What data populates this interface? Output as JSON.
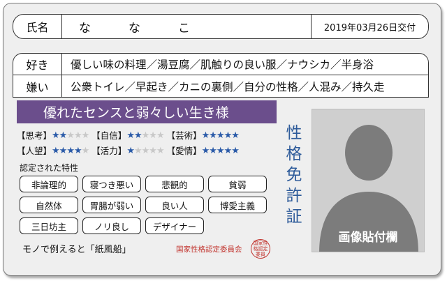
{
  "name_row": {
    "label": "氏名",
    "value": "ななこ",
    "issue_date": "2019年03月26日交付"
  },
  "likes": {
    "label": "好き",
    "value": "優しい味の料理／湯豆腐／肌触りの良い服／ナウシカ／半身浴"
  },
  "dislikes": {
    "label": "嫌い",
    "value": "公衆トイレ／早起き／カニの裏側／自分の性格／人混み／持久走"
  },
  "banner": "優れたセンスと弱々しい生き様",
  "stats": [
    {
      "label": "【思考】",
      "rating": 2,
      "max": 5
    },
    {
      "label": "【自信】",
      "rating": 2,
      "max": 5
    },
    {
      "label": "【芸術】",
      "rating": 5,
      "max": 5
    },
    {
      "label": "【人望】",
      "rating": 4,
      "max": 5
    },
    {
      "label": "【活力】",
      "rating": 1,
      "max": 5
    },
    {
      "label": "【愛情】",
      "rating": 5,
      "max": 5
    }
  ],
  "traits_label": "認定された特性",
  "traits": [
    "非論理的",
    "寝つき悪い",
    "悲観的",
    "貧弱",
    "自然体",
    "胃腸が弱い",
    "良い人",
    "博愛主義",
    "三日坊主",
    "ノリ良し",
    "デザイナー"
  ],
  "motto": "モノで例えると「紙風船」",
  "committee": "国家性格認定委員会",
  "seal_text": "国家性格認定委員",
  "vertical_title": [
    "性",
    "格",
    "免",
    "許",
    "証"
  ],
  "photo_label": "画像貼付欄",
  "colors": {
    "banner": "#6b4e8c",
    "star_on": "#2a5aa8",
    "star_off": "#c8c8c8",
    "title": "#2e5b9a",
    "seal": "#c0302a"
  }
}
